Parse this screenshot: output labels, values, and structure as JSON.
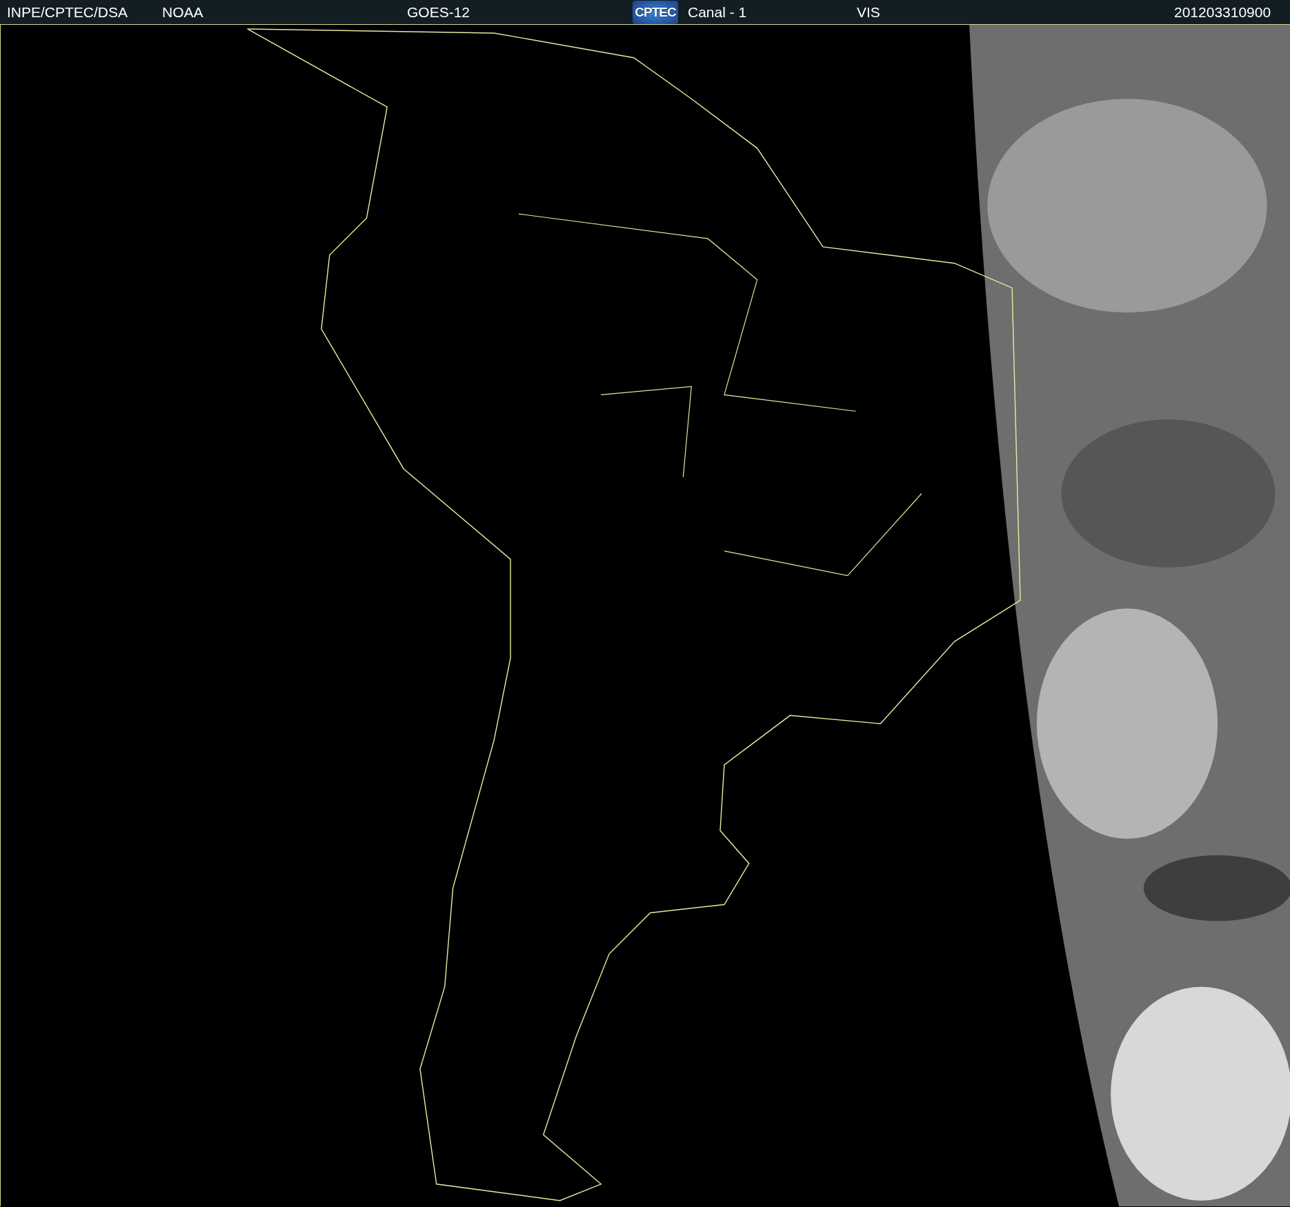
{
  "header": {
    "source": "INPE/CPTEC/DSA",
    "agency": "NOAA",
    "satellite": "GOES-12",
    "logo": "CPTEC",
    "channel": "Canal - 1",
    "band": "VIS",
    "timestamp": "201203310900"
  }
}
